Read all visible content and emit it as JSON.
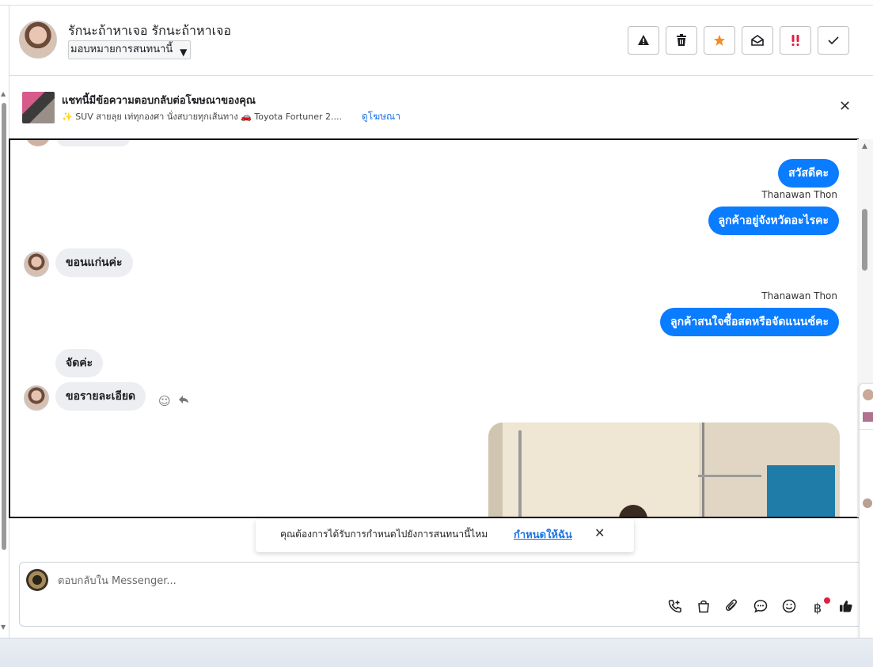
{
  "header": {
    "contact_name": "รักนะถ้าหาเจอ รักนะถ้าหาเจอ",
    "assign_label": "มอบหมายการสนทนานี้",
    "buttons": [
      "warning",
      "delete",
      "star",
      "mark-unread",
      "priority",
      "done"
    ]
  },
  "ad": {
    "title": "แชทนี้มีข้อความตอบกลับต่อโฆษณาของคุณ",
    "description": "✨ SUV สายลุย เท่ทุกองศา นั่งสบายทุกเส้นทาง 🚗 Toyota Fortuner 2....",
    "link": "ดูโฆษณา"
  },
  "messages": {
    "out_1": "สวัสดีคะ",
    "sender_1": "Thanawan Thon",
    "out_2": "ลูกค้าอยู่จังหวัดอะไรคะ",
    "in_1": "ขอนแก่นค่ะ",
    "sender_2": "Thanawan Thon",
    "out_3": "ลูกค้าสนใจซื้อสดหรือจัดแนนซ์คะ",
    "in_2": "จัดค่ะ",
    "in_3": "ขอรายละเอียด"
  },
  "notice": {
    "text": "คุณต้องการได้รับการกำหนดไปยังการสนทนานี้ไหม",
    "link": "กำหนดให้ฉัน"
  },
  "composer": {
    "placeholder": "ตอบกลับใน Messenger..."
  },
  "colors": {
    "outgoing_bubble": "#0a7cff",
    "incoming_bubble": "#eceef1",
    "link": "#1b74e4",
    "star": "#f28c28",
    "priority": "#e41e3f"
  }
}
